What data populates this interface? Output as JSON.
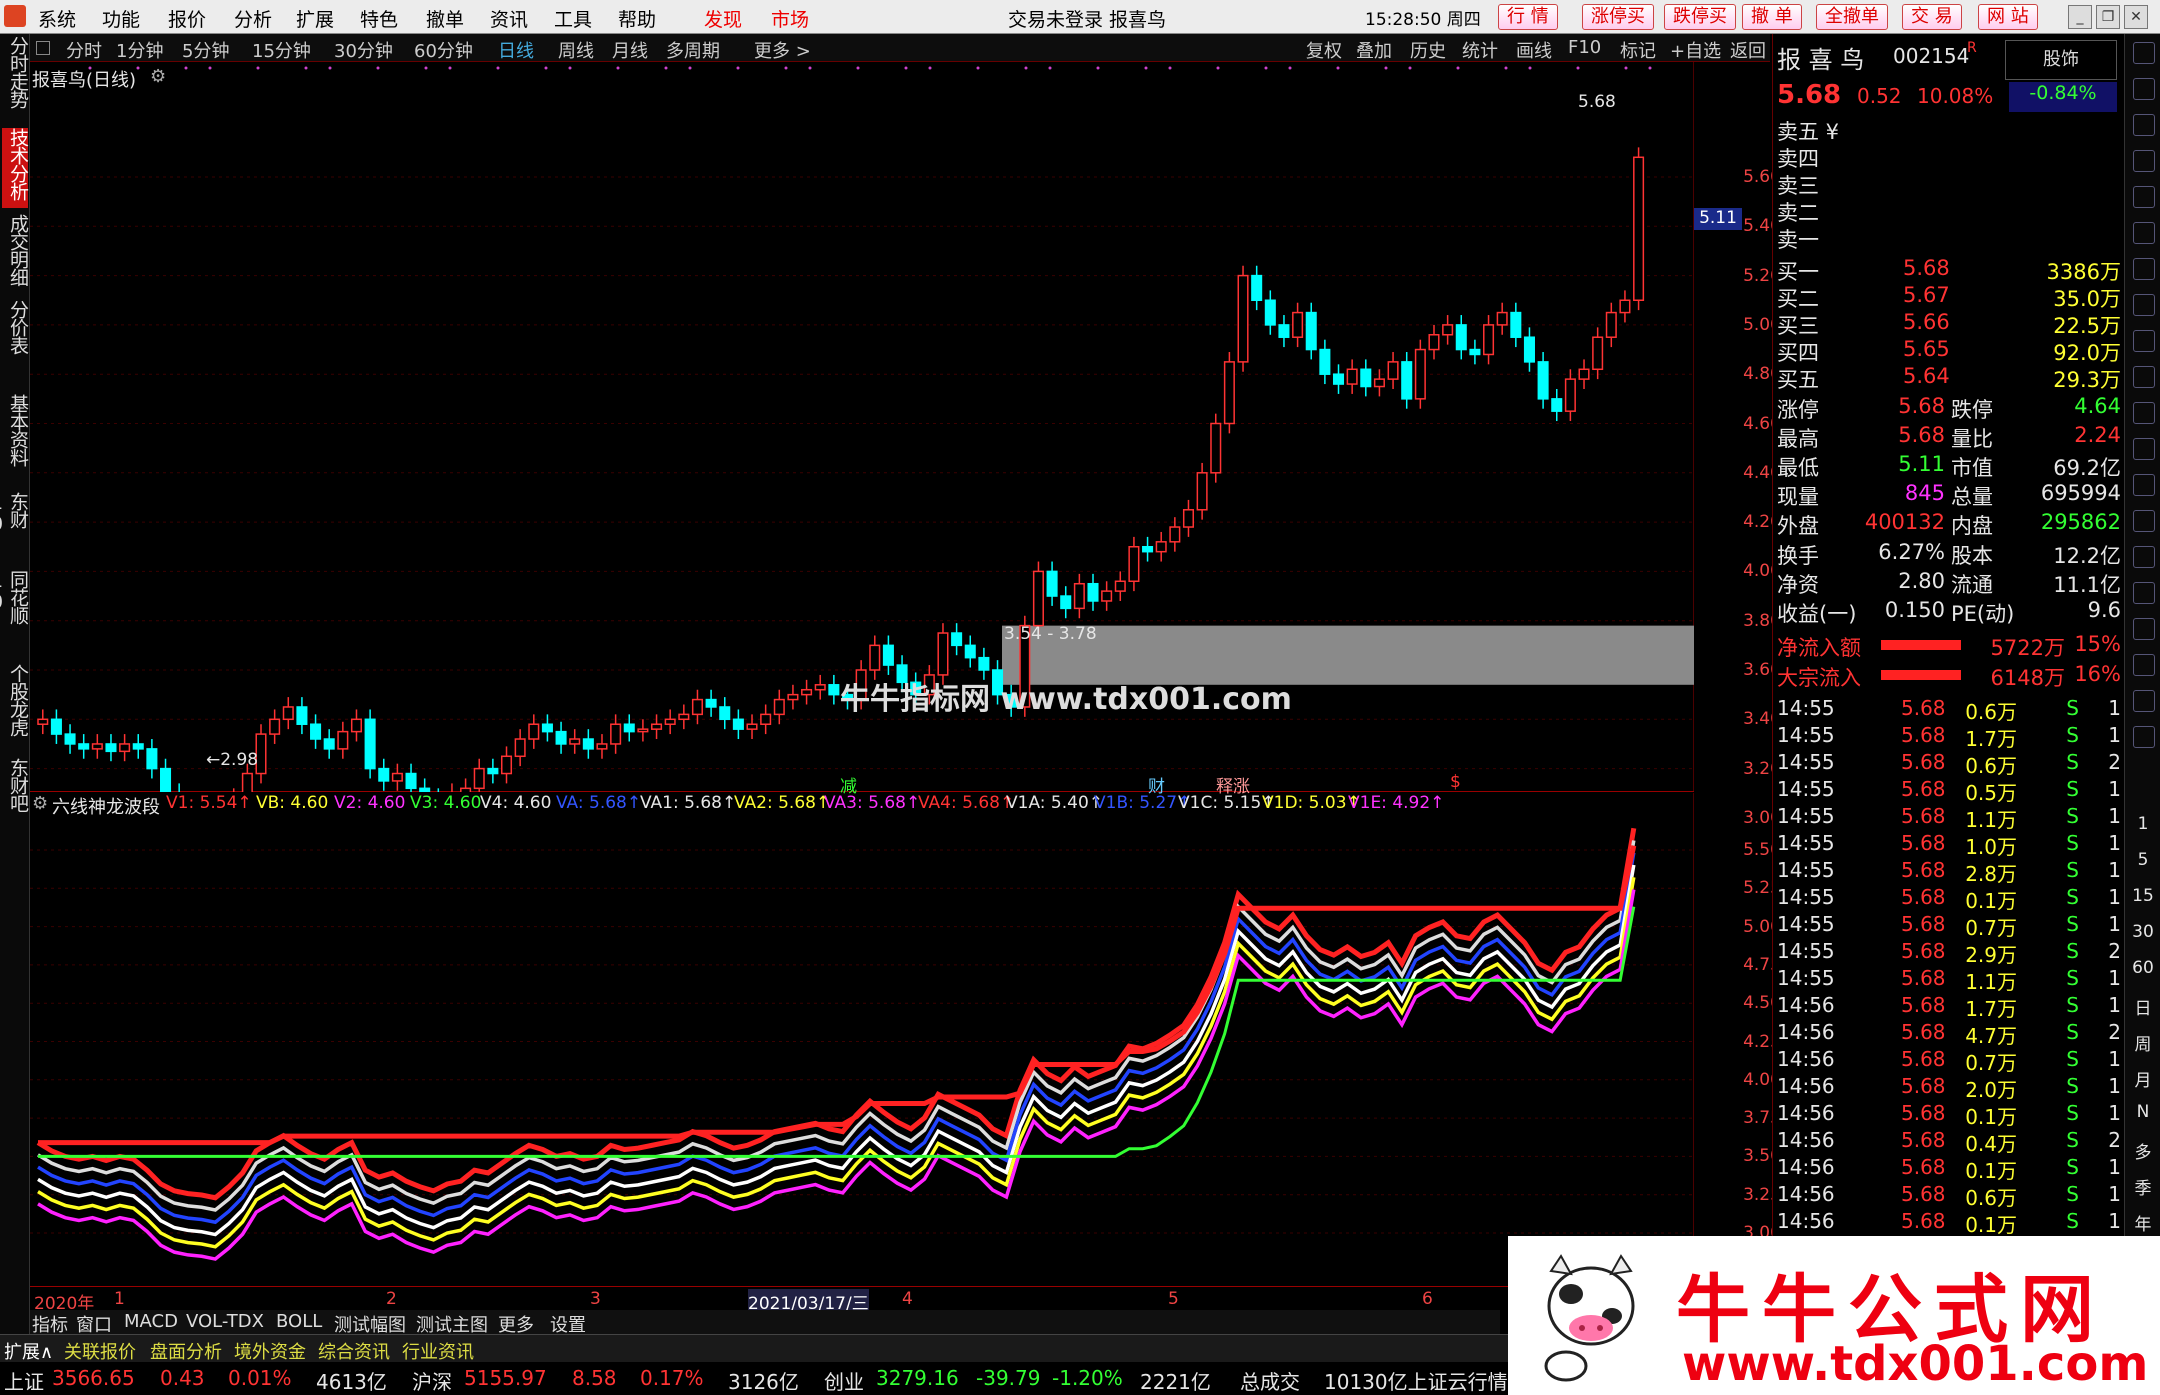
{
  "menubar": {
    "items": [
      "系统",
      "功能",
      "报价",
      "分析",
      "扩展",
      "特色",
      "撤单",
      "资讯",
      "工具",
      "帮助"
    ],
    "discover": "发现",
    "market": "市场",
    "title": "交易未登录  报喜鸟",
    "time": "15:28:50 周四",
    "quick": [
      "行 情",
      "涨停买",
      "跌停买",
      "撤 单",
      "全撤单",
      "交 易",
      "网 站"
    ]
  },
  "lefttabs": [
    "分时走势",
    "技术分析",
    "成交明细",
    "分价表",
    "基本资料",
    "东财10",
    "同花顺10",
    "个股龙虎",
    "东财吧"
  ],
  "periods": [
    "分时",
    "1分钟",
    "5分钟",
    "15分钟",
    "30分钟",
    "60分钟",
    "日线",
    "周线",
    "月线",
    "多周期",
    "更多 >"
  ],
  "tools": [
    "复权",
    "叠加",
    "历史",
    "统计",
    "画线",
    "F10",
    "标记",
    "+自选",
    "返回"
  ],
  "kline": {
    "title": "报喜鸟(日线)",
    "axis": [
      "5.60",
      "5.40",
      "5.20",
      "5.00",
      "4.80",
      "4.60",
      "4.40",
      "4.20",
      "4.00",
      "3.80",
      "3.60",
      "3.40",
      "3.20",
      "3.00"
    ],
    "high_label": "5.68",
    "low_label": "←2.98",
    "zone_label": "3.54 - 3.78",
    "price_tag": "5.11",
    "markers": [
      {
        "t": "减",
        "c": "#33ff33"
      },
      {
        "t": "财",
        "c": "#66ccff"
      },
      {
        "t": "释涨",
        "c": "#ff9999"
      },
      {
        "t": "$",
        "c": "#ff3333"
      }
    ],
    "watermark": "牛牛指标网 www.tdx001.com"
  },
  "indicator": {
    "title": "六线神龙波段",
    "vals": [
      {
        "t": "V1: 5.54↑",
        "c": "#ff3333"
      },
      {
        "t": "VB: 4.60",
        "c": "#ffff33"
      },
      {
        "t": "V2: 4.60",
        "c": "#ff33ff"
      },
      {
        "t": "V3: 4.60",
        "c": "#33ff33"
      },
      {
        "t": "V4: 4.60",
        "c": "#e6e6e6"
      },
      {
        "t": "VA: 5.68↑",
        "c": "#3355ff"
      },
      {
        "t": "VA1: 5.68↑",
        "c": "#e6e6e6"
      },
      {
        "t": "VA2: 5.68↑",
        "c": "#ffff33"
      },
      {
        "t": "VA3: 5.68↑",
        "c": "#ff33ff"
      },
      {
        "t": "VA4: 5.68↑",
        "c": "#ff3333"
      },
      {
        "t": "V1A: 5.40↑",
        "c": "#e6e6e6"
      },
      {
        "t": "V1B: 5.27↑",
        "c": "#3355ff"
      },
      {
        "t": "V1C: 5.15↑",
        "c": "#e6e6e6"
      },
      {
        "t": "V1D: 5.03↑",
        "c": "#ffff33"
      },
      {
        "t": "V1E: 4.92↑",
        "c": "#ff33ff"
      }
    ],
    "axis": [
      "5.50",
      "5.25",
      "5.00",
      "4.75",
      "4.50",
      "4.25",
      "4.00",
      "3.75",
      "3.50",
      "3.25",
      "3.00"
    ]
  },
  "xaxis": [
    "2020年",
    "1",
    "2",
    "3",
    "2021/03/17/三",
    "4",
    "5",
    "6"
  ],
  "btabs": [
    "指标",
    "窗口",
    "MACD",
    "VOL-TDX",
    "BOLL",
    "测试幅图",
    "测试主图",
    "更多",
    "设置"
  ],
  "status1": [
    "扩展∧",
    "关联报价",
    "盘面分析",
    "境外资金",
    "综合资讯",
    "行业资讯"
  ],
  "status2": {
    "sh": "上证",
    "sh_v": "3566.65",
    "sh_c": "0.43",
    "sh_p": "0.01%",
    "sh_a": "4613亿",
    "hs": "沪深",
    "hs_v": "5155.97",
    "hs_c": "8.58",
    "hs_p": "0.17%",
    "hs_a": "3126亿",
    "cy": "创业",
    "cy_v": "3279.16",
    "cy_c": "-39.79",
    "cy_p": "-1.20%",
    "cy_a": "2221亿",
    "tot": "总成交",
    "tot_v": "10130亿上证云行情"
  },
  "quote": {
    "name": "报 喜 鸟",
    "code": "002154",
    "r": "R",
    "btn": "股饰",
    "price": "5.68",
    "chg": "0.52",
    "pct": "10.08%",
    "idx": "-0.84%",
    "sells": [
      "卖五 ¥",
      "卖四",
      "卖三",
      "卖二",
      "卖一"
    ],
    "buys": [
      [
        "买一",
        "5.68",
        "3386万"
      ],
      [
        "买二",
        "5.67",
        "35.0万"
      ],
      [
        "买三",
        "5.66",
        "22.5万"
      ],
      [
        "买四",
        "5.65",
        "92.0万"
      ],
      [
        "买五",
        "5.64",
        "29.3万"
      ]
    ],
    "stats": [
      [
        "涨停",
        "5.68",
        "跌停",
        "4.64"
      ],
      [
        "最高",
        "5.68",
        "量比",
        "2.24"
      ],
      [
        "最低",
        "5.11",
        "市值",
        "69.2亿"
      ],
      [
        "现量",
        "845",
        "总量",
        "695994"
      ],
      [
        "外盘",
        "400132",
        "内盘",
        "295862"
      ]
    ],
    "stats2": [
      [
        "换手",
        "6.27%",
        "股本",
        "12.2亿"
      ],
      [
        "净资",
        "2.80",
        "流通",
        "11.1亿"
      ],
      [
        "收益(一)",
        "0.150",
        "PE(动)",
        "9.6"
      ]
    ],
    "flow": [
      [
        "净流入额",
        "5722万",
        "15%"
      ],
      [
        "大宗流入",
        "6148万",
        "16%"
      ]
    ],
    "ticks": [
      [
        "14:55",
        "5.68",
        "0.6万",
        "S",
        "1"
      ],
      [
        "14:55",
        "5.68",
        "1.7万",
        "S",
        "1"
      ],
      [
        "14:55",
        "5.68",
        "0.6万",
        "S",
        "2"
      ],
      [
        "14:55",
        "5.68",
        "0.5万",
        "S",
        "1"
      ],
      [
        "14:55",
        "5.68",
        "1.1万",
        "S",
        "1"
      ],
      [
        "14:55",
        "5.68",
        "1.0万",
        "S",
        "1"
      ],
      [
        "14:55",
        "5.68",
        "2.8万",
        "S",
        "1"
      ],
      [
        "14:55",
        "5.68",
        "0.1万",
        "S",
        "1"
      ],
      [
        "14:55",
        "5.68",
        "0.7万",
        "S",
        "1"
      ],
      [
        "14:55",
        "5.68",
        "2.9万",
        "S",
        "2"
      ],
      [
        "14:55",
        "5.68",
        "1.1万",
        "S",
        "1"
      ],
      [
        "14:56",
        "5.68",
        "1.7万",
        "S",
        "1"
      ],
      [
        "14:56",
        "5.68",
        "4.7万",
        "S",
        "2"
      ],
      [
        "14:56",
        "5.68",
        "0.7万",
        "S",
        "1"
      ],
      [
        "14:56",
        "5.68",
        "2.0万",
        "S",
        "1"
      ],
      [
        "14:56",
        "5.68",
        "0.1万",
        "S",
        "1"
      ],
      [
        "14:56",
        "5.68",
        "0.4万",
        "S",
        "2"
      ],
      [
        "14:56",
        "5.68",
        "0.1万",
        "S",
        "1"
      ],
      [
        "14:56",
        "5.68",
        "0.6万",
        "S",
        "1"
      ],
      [
        "14:56",
        "5.68",
        "0.1万",
        "S",
        "1"
      ]
    ]
  },
  "rtool": [
    "1",
    "5",
    "15",
    "30",
    "60",
    "日",
    "周",
    "月",
    "N",
    "多",
    "季",
    "年"
  ],
  "ad": {
    "title": "牛牛公式网",
    "url": "www.tdx001.com"
  },
  "chart_data": {
    "type": "candlestick",
    "closes": [
      3.4,
      3.34,
      3.3,
      3.28,
      3.3,
      3.27,
      3.3,
      3.28,
      3.2,
      3.1,
      3.05,
      3.03,
      3.02,
      3.0,
      3.08,
      3.18,
      3.34,
      3.4,
      3.45,
      3.38,
      3.32,
      3.28,
      3.35,
      3.4,
      3.2,
      3.15,
      3.18,
      3.12,
      3.08,
      3.05,
      3.1,
      3.12,
      3.2,
      3.18,
      3.25,
      3.32,
      3.38,
      3.35,
      3.3,
      3.32,
      3.28,
      3.3,
      3.38,
      3.35,
      3.36,
      3.38,
      3.4,
      3.42,
      3.48,
      3.45,
      3.4,
      3.36,
      3.38,
      3.42,
      3.48,
      3.5,
      3.52,
      3.54,
      3.5,
      3.48,
      3.6,
      3.7,
      3.62,
      3.55,
      3.5,
      3.58,
      3.75,
      3.7,
      3.65,
      3.6,
      3.5,
      3.45,
      3.78,
      4.0,
      3.9,
      3.85,
      3.95,
      3.88,
      3.92,
      3.96,
      4.1,
      4.08,
      4.12,
      4.18,
      4.25,
      4.4,
      4.6,
      4.85,
      5.2,
      5.1,
      5.0,
      4.95,
      5.05,
      4.9,
      4.8,
      4.76,
      4.82,
      4.75,
      4.78,
      4.85,
      4.7,
      4.9,
      4.96,
      5.0,
      4.9,
      4.88,
      5.0,
      5.05,
      4.95,
      4.85,
      4.7,
      4.65,
      4.78,
      4.82,
      4.95,
      5.05,
      5.1,
      5.68
    ]
  }
}
